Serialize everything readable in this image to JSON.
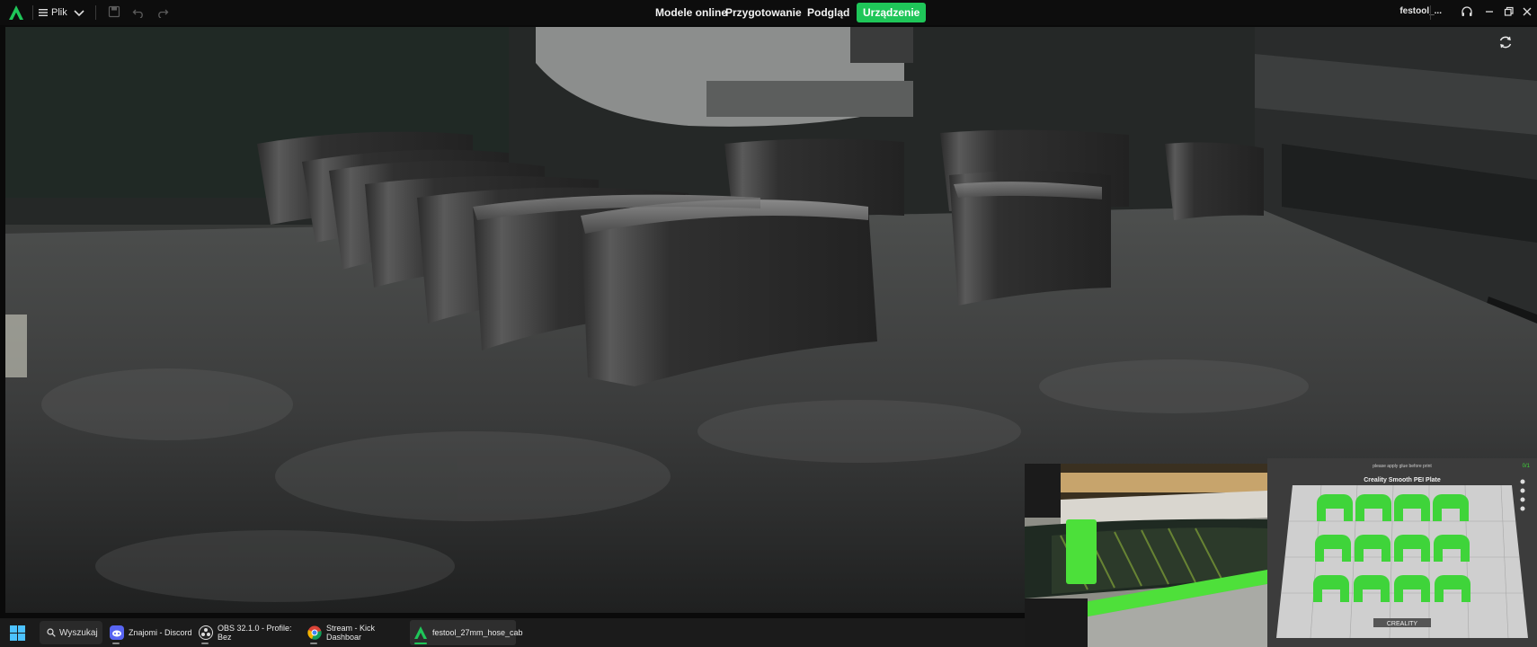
{
  "titlebar": {
    "menu_label": "Plik",
    "nav": [
      "Modele online",
      "Przygotowanie",
      "Podgląd",
      "Urządzenie"
    ],
    "active_tab": "Urządzenie",
    "file_name": "festool_..."
  },
  "thumbnail": {
    "plate_label": "Creality Smooth PEI Plate",
    "top_text": "please apply glue before print",
    "counter": "0/1",
    "brand": "CREALITY"
  },
  "taskbar": {
    "search_label": "Wyszukaj",
    "apps": [
      {
        "label": "Znajomi - Discord",
        "icon": "discord-icon"
      },
      {
        "label": "OBS 32.1.0 - Profile: Bez",
        "icon": "obs-icon"
      },
      {
        "label": "Stream - Kick Dashboar",
        "icon": "chrome-icon"
      },
      {
        "label": "festool_27mm_hose_cab",
        "icon": "creality-print-icon"
      }
    ]
  },
  "colors": {
    "accent": "#1fc659",
    "filament": "#3cd43c",
    "titlebar_bg": "#0d0d0d",
    "taskbar_bg": "#1b1b1b"
  }
}
